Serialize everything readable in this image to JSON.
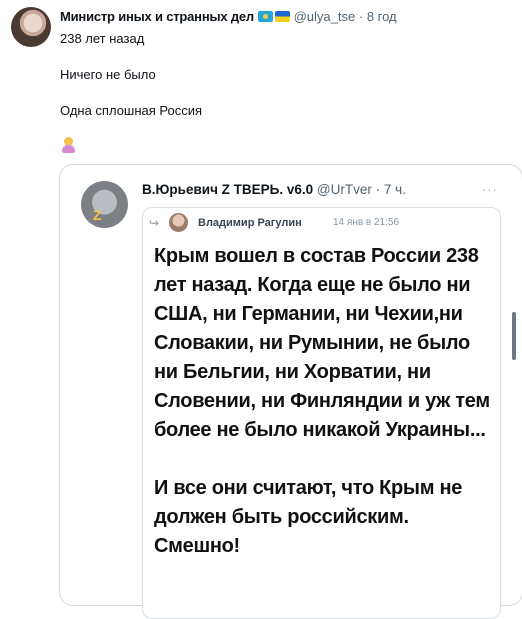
{
  "tweet": {
    "author_name": "Министр иных и странных дел",
    "handle": "@ulya_tse",
    "separator": "·",
    "time": "8 год",
    "lines": [
      "238 лет назад",
      "Ничего не было",
      "Одна сплошная Россия"
    ],
    "emoji_name": "woman-shrugging-emoji"
  },
  "quote": {
    "author_name": "В.Юрьевич Z ТВЕРЬ. v6.0",
    "handle": "@UrTver",
    "separator": "·",
    "time": "7 ч.",
    "more_label": "···",
    "card": {
      "reply_icon": "reply-arrow-icon",
      "author_name": "Владимир Рагулин",
      "date": "14 янв в 21:56",
      "text": "Крым вошел в состав России 238 лет назад. Когда еще не было ни США, ни Германии, ни Чехии,ни Словакии, ни Румынии, не было ни Бельгии, ни Хорватии, ни Словении, ни Финляндии и уж тем более не было никакой Украины...\n\nИ все они считают, что Крым не должен быть российским. Смешно!"
    }
  }
}
